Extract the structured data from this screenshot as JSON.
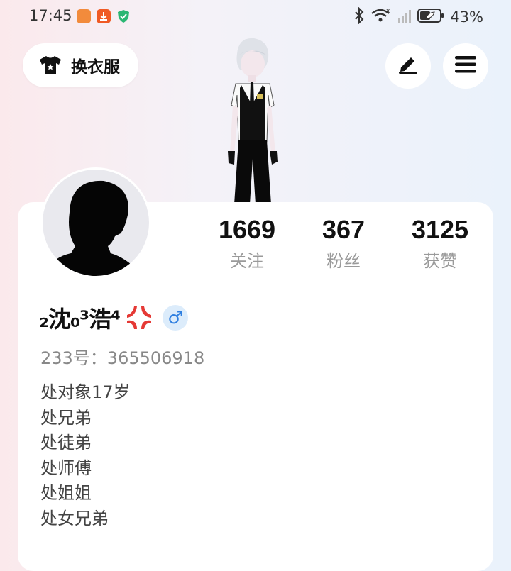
{
  "status_bar": {
    "time": "17:45",
    "battery": "43%",
    "icons": [
      "app-icon-orange",
      "download-icon",
      "shield-icon",
      "bluetooth-icon",
      "wifi-icon",
      "signal-icon",
      "battery-icon"
    ]
  },
  "header": {
    "outfit_button_label": "换衣服",
    "outfit_icon": "tshirt-icon",
    "edit_icon": "pen-icon",
    "menu_icon": "menu-icon"
  },
  "stats": [
    {
      "count": "1669",
      "label": "关注"
    },
    {
      "count": "367",
      "label": "粉丝"
    },
    {
      "count": "3125",
      "label": "获赞"
    }
  ],
  "profile": {
    "name": "₂沈₀³浩⁴",
    "emoji": "anger-symbol-icon",
    "gender": "♂",
    "uid": "233号：365506918",
    "bio": [
      "处对象17岁",
      "处兄弟",
      "处徒弟",
      "处师傅",
      "处姐姐",
      "处女兄弟"
    ]
  },
  "colors": {
    "gender_badge_bg": "#dcecfb",
    "gender_symbol": "#2f7fe0",
    "anger_red": "#e53935"
  }
}
